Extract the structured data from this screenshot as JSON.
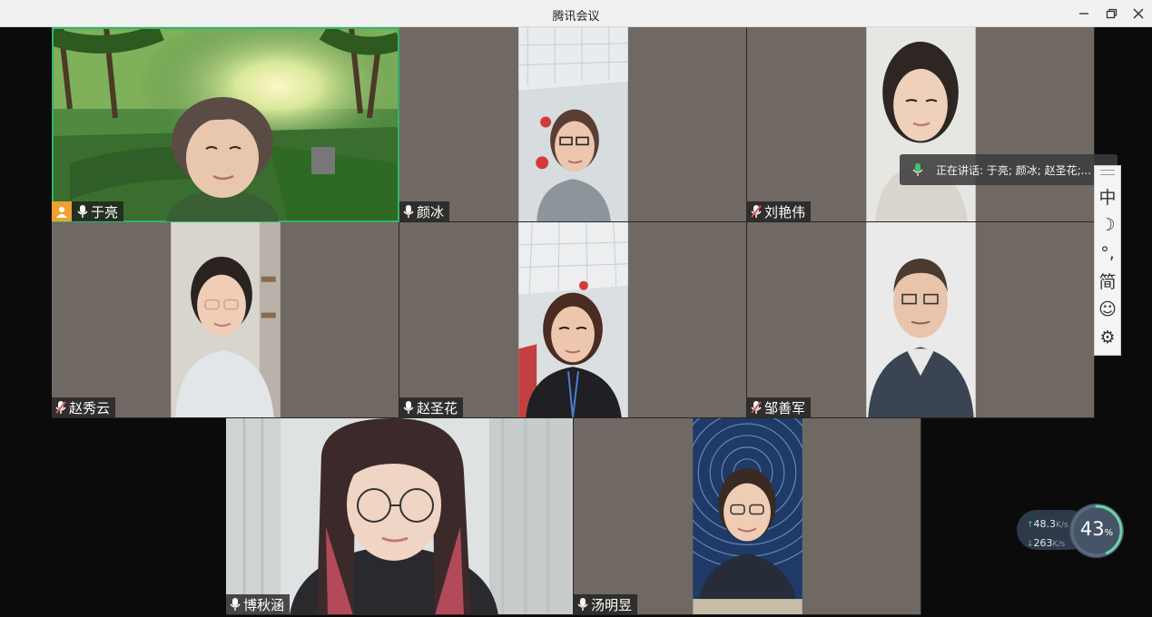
{
  "window": {
    "title": "腾讯会议"
  },
  "speaking": {
    "text": "正在讲话: 于亮; 颜冰; 赵圣花;..."
  },
  "participants": [
    {
      "name": "于亮",
      "mic": "on",
      "host": true,
      "active": true
    },
    {
      "name": "颜冰",
      "mic": "on"
    },
    {
      "name": "刘艳伟",
      "mic": "muted"
    },
    {
      "name": "赵秀云",
      "mic": "muted"
    },
    {
      "name": "赵圣花",
      "mic": "on"
    },
    {
      "name": "邹善军",
      "mic": "muted"
    },
    {
      "name": "博秋涵",
      "mic": "on"
    },
    {
      "name": "汤明昱",
      "mic": "on"
    }
  ],
  "ime_toolbar": {
    "mode": "中",
    "moon": "☽",
    "punct": "°,",
    "script": "简",
    "emoji": "☺",
    "settings": "⚙"
  },
  "network": {
    "upload": "48.3",
    "upload_unit": "K/s",
    "download": "263",
    "download_unit": "K/s",
    "cpu_percent": "43",
    "cpu_symbol": "%",
    "cpu_fraction": 0.43
  },
  "colors": {
    "active_border": "#2fb46a",
    "host_badge": "#f0a030",
    "muted_mic": "#d9534f",
    "mic_on": "#ffffff"
  }
}
